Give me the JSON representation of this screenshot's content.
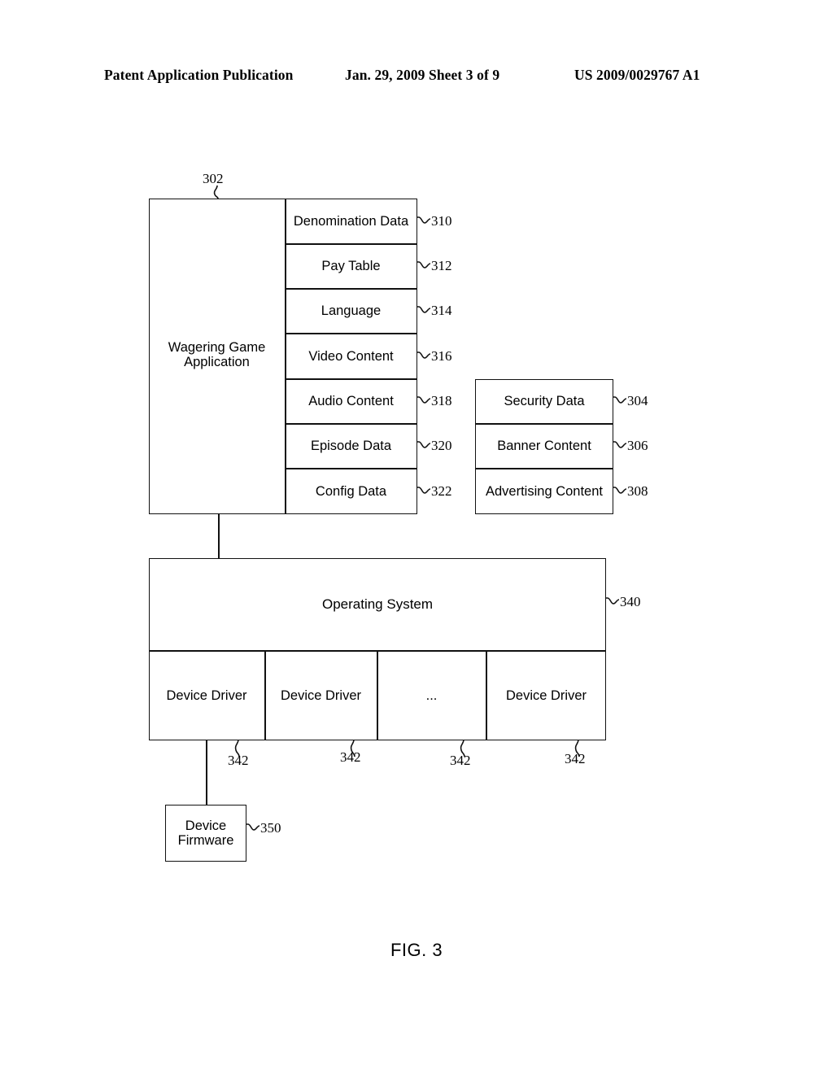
{
  "header": {
    "publication": "Patent Application Publication",
    "date_sheet": "Jan. 29, 2009  Sheet 3 of 9",
    "doc_number": "US 2009/0029767 A1"
  },
  "figure": {
    "caption": "FIG. 3",
    "app_block": {
      "label": "Wagering Game Application",
      "ref": "302"
    },
    "app_components": [
      {
        "label": "Denomination Data",
        "ref": "310"
      },
      {
        "label": "Pay Table",
        "ref": "312"
      },
      {
        "label": "Language",
        "ref": "314"
      },
      {
        "label": "Video Content",
        "ref": "316"
      },
      {
        "label": "Audio Content",
        "ref": "318"
      },
      {
        "label": "Episode Data",
        "ref": "320"
      },
      {
        "label": "Config Data",
        "ref": "322"
      }
    ],
    "side_components": [
      {
        "label": "Security Data",
        "ref": "304"
      },
      {
        "label": "Banner Content",
        "ref": "306"
      },
      {
        "label": "Advertising Content",
        "ref": "308"
      }
    ],
    "operating_system": {
      "label": "Operating System",
      "ref": "340"
    },
    "device_drivers": [
      {
        "label": "Device Driver",
        "ref": "342"
      },
      {
        "label": "Device Driver",
        "ref": "342"
      },
      {
        "label": "...",
        "ref": "342"
      },
      {
        "label": "Device Driver",
        "ref": "342"
      }
    ],
    "device_firmware": {
      "label": "Device Firmware",
      "ref": "350"
    }
  },
  "colors": {
    "ink": "#111111",
    "page": "#ffffff"
  }
}
